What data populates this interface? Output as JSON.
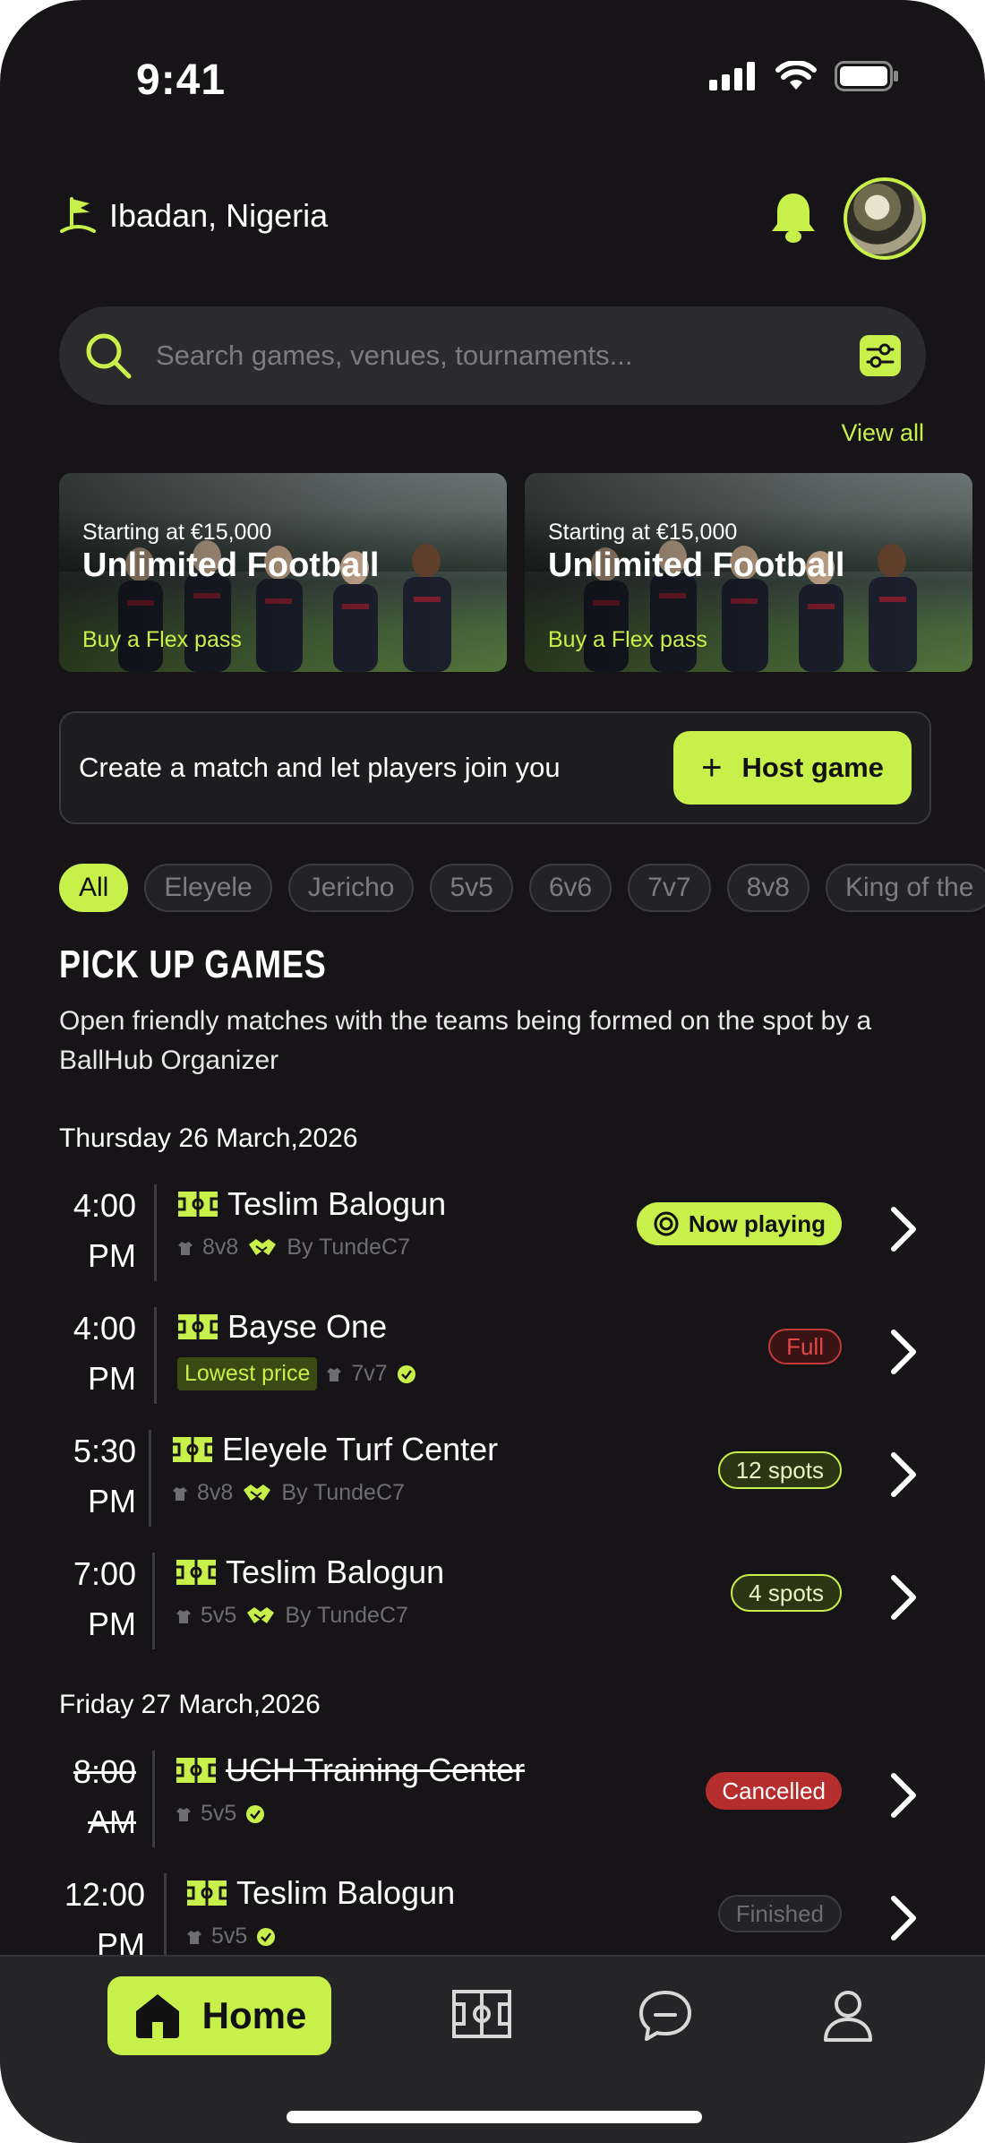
{
  "status_bar": {
    "time": "9:41"
  },
  "header": {
    "location": "Ibadan, Nigeria"
  },
  "search": {
    "placeholder": "Search games, venues, tournaments..."
  },
  "promos": {
    "view_all": "View all",
    "cards": [
      {
        "kicker": "Starting at €15,000",
        "title": "Unlimited Football",
        "cta": "Buy a Flex pass"
      },
      {
        "kicker": "Starting at €15,000",
        "title": "Unlimited Football",
        "cta": "Buy a Flex pass"
      }
    ]
  },
  "host": {
    "text": "Create a match and let players join you",
    "button": "Host game"
  },
  "filters": [
    "All",
    "Eleyele",
    "Jericho",
    "5v5",
    "6v6",
    "7v7",
    "8v8",
    "King of the"
  ],
  "section": {
    "title": "PICK UP GAMES",
    "description": "Open friendly matches with the teams being formed on the spot by a BallHub Organizer"
  },
  "days": [
    {
      "date": "Thursday 26 March,2026",
      "games": [
        {
          "time": "4:00",
          "ampm": "PM",
          "venue": "Teslim Balogun",
          "format": "8v8",
          "organizer": "By TundeC7",
          "status": "Now playing"
        },
        {
          "time": "4:00",
          "ampm": "PM",
          "venue": "Bayse One",
          "tag": "Lowest price",
          "format": "7v7",
          "status": "Full"
        },
        {
          "time": "5:30",
          "ampm": "PM",
          "venue": "Eleyele Turf Center",
          "format": "8v8",
          "organizer": "By TundeC7",
          "status": "12 spots"
        },
        {
          "time": "7:00",
          "ampm": "PM",
          "venue": "Teslim Balogun",
          "format": "5v5",
          "organizer": "By TundeC7",
          "status": "4 spots"
        }
      ]
    },
    {
      "date": "Friday 27 March,2026",
      "games": [
        {
          "time": "8:00",
          "ampm": "AM",
          "venue": "UCH Training Center",
          "format": "5v5",
          "status": "Cancelled"
        },
        {
          "time": "12:00",
          "ampm": "PM",
          "venue": "Teslim Balogun",
          "format": "5v5",
          "status": "Finished"
        }
      ]
    }
  ],
  "nav": {
    "home": "Home"
  },
  "colors": {
    "accent": "#c8f04a",
    "background": "#161416",
    "danger": "#b52d2d"
  },
  "icons": [
    "location-flag-icon",
    "bell-icon",
    "search-icon",
    "filter-icon",
    "pitch-icon",
    "jersey-icon",
    "handshake-icon",
    "verified-icon",
    "chevron-right-icon",
    "home-icon",
    "chat-icon",
    "profile-icon"
  ]
}
